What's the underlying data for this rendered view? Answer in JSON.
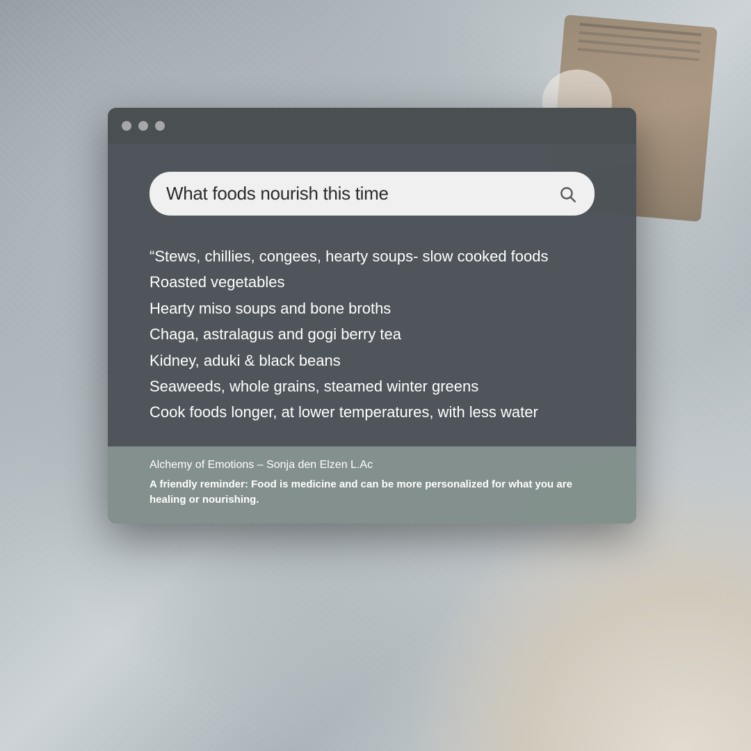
{
  "background": {
    "alt": "Cozy winter scene with knit blanket, notebook and coffee cup"
  },
  "window": {
    "titlebar": {
      "buttons": [
        "close",
        "minimize",
        "maximize"
      ]
    },
    "search": {
      "query": "What foods nourish this time",
      "placeholder": "What foods nourish this time",
      "icon": "🔍"
    },
    "results": {
      "lines": [
        "“Stews, chillies, congees, hearty soups- slow cooked foods",
        "Roasted vegetables",
        "Hearty miso soups and bone broths",
        "Chaga, astralagus and gogi berry tea",
        "Kidney, aduki & black beans",
        "Seaweeds, whole grains, steamed winter greens",
        "Cook foods longer, at lower temperatures, with less water"
      ]
    },
    "footer": {
      "attribution": "Alchemy of Emotions – Sonja den Elzen L.Ac",
      "reminder": "A friendly reminder:  Food is medicine and can be more personalized for what you are healing or nourishing."
    }
  }
}
